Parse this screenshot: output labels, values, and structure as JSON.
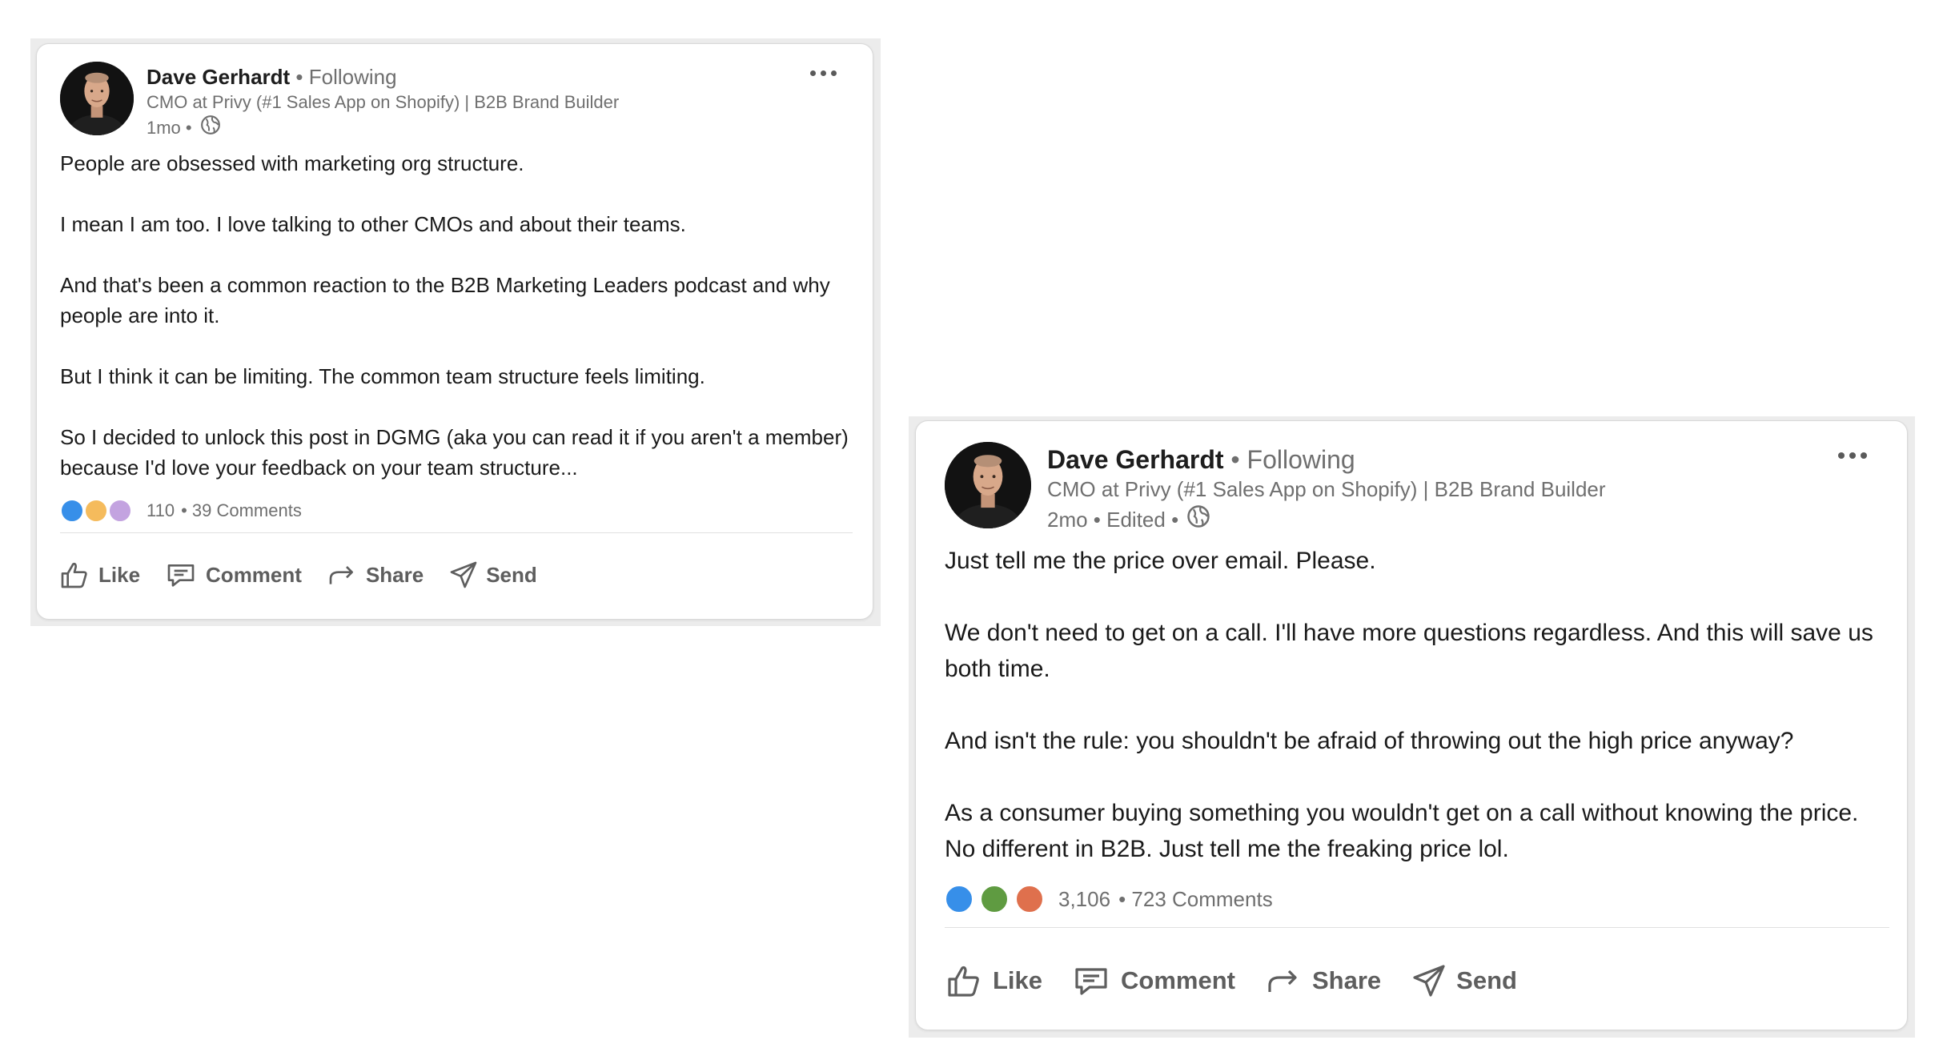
{
  "posts": [
    {
      "author": "Dave Gerhardt",
      "follow": "• Following",
      "headline": "CMO at Privy (#1 Sales App on Shopify) | B2B Brand Builder",
      "meta": "1mo •",
      "paragraphs": [
        "People are obsessed with marketing org structure.",
        "I mean I am too. I love talking to other CMOs and about their teams.",
        "And that's been a common reaction to the B2B Marketing Leaders podcast and why people are into it.",
        "But I think it can be limiting. The common team structure feels limiting.",
        "So I decided to unlock this post in DGMG (aka you can read it if you aren't a member) because I'd love your feedback on your team structure..."
      ],
      "reactions_count": "110",
      "comments": "• 39 Comments",
      "reaction_icons": [
        "like-icon",
        "insightful-icon",
        "curious-icon"
      ],
      "actions": {
        "like": "Like",
        "comment": "Comment",
        "share": "Share",
        "send": "Send"
      }
    },
    {
      "author": "Dave Gerhardt",
      "follow": "• Following",
      "headline": "CMO at Privy (#1 Sales App on Shopify) | B2B Brand Builder",
      "meta": "2mo • Edited •",
      "paragraphs": [
        "Just tell me the price over email. Please.",
        "We don't need to get on a call. I'll have more questions regardless. And this will save us both time.",
        "And isn't the rule: you shouldn't be afraid of throwing out the high price anyway?",
        "As a consumer buying something you wouldn't get on a call without knowing the price. No different in B2B. Just tell me the freaking price lol."
      ],
      "reactions_count": "3,106",
      "comments": "• 723 Comments",
      "reaction_icons": [
        "like-icon",
        "celebrate-icon",
        "love-icon"
      ],
      "actions": {
        "like": "Like",
        "comment": "Comment",
        "share": "Share",
        "send": "Send"
      }
    }
  ],
  "colors": {
    "like": "#378fe9",
    "insightful": "#f5bb5c",
    "curious": "#c3a3e0",
    "celebrate": "#5f9b41",
    "love": "#df704d",
    "muted": "#6f6f6f"
  }
}
